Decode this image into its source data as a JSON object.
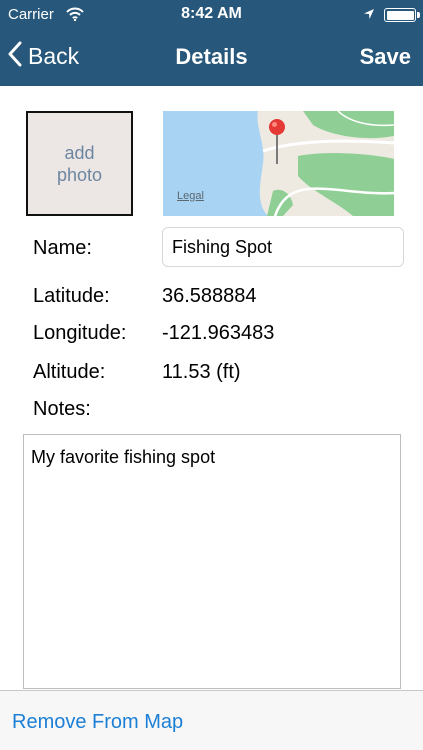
{
  "status_bar": {
    "carrier": "Carrier",
    "time": "8:42 AM",
    "icons": [
      "wifi-icon",
      "location-arrow-icon",
      "battery-icon"
    ]
  },
  "nav": {
    "back_label": "Back",
    "title": "Details",
    "save_label": "Save"
  },
  "photo": {
    "label": "add photo"
  },
  "map": {
    "legal_label": "Legal",
    "pin_icon": "map-pin-icon"
  },
  "form": {
    "name_label": "Name:",
    "name_value": "Fishing Spot",
    "latitude_label": "Latitude:",
    "latitude_value": "36.588884",
    "longitude_label": "Longitude:",
    "longitude_value": "-121.963483",
    "altitude_label": "Altitude:",
    "altitude_value": "11.53 (ft)",
    "notes_label": "Notes:",
    "notes_value": "My favorite fishing spot"
  },
  "toolbar": {
    "remove_label": "Remove From Map"
  },
  "colors": {
    "nav_background": "#27577a",
    "link_blue": "#1c7fd5",
    "photo_placeholder_text": "#6d86a0",
    "pin_red": "#e53935"
  }
}
